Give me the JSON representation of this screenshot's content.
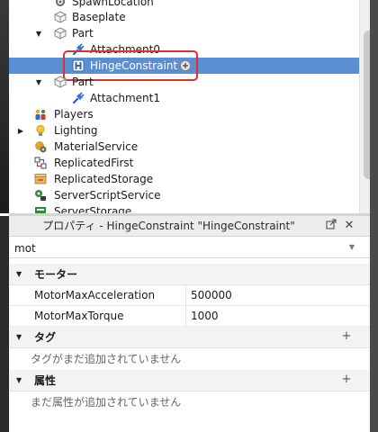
{
  "explorer": {
    "items": [
      {
        "label": "SpawnLocation",
        "icon": "spawn-icon"
      },
      {
        "label": "Baseplate",
        "icon": "part-icon"
      },
      {
        "label": "Part",
        "icon": "part-icon",
        "expanded": true
      },
      {
        "label": "Attachment0",
        "icon": "attachment-icon"
      },
      {
        "label": "HingeConstraint",
        "icon": "hinge-icon",
        "selected": true
      },
      {
        "label": "Part",
        "icon": "part-icon",
        "expanded": true
      },
      {
        "label": "Attachment1",
        "icon": "attachment-icon"
      },
      {
        "label": "Players",
        "icon": "players-icon"
      },
      {
        "label": "Lighting",
        "icon": "lighting-icon"
      },
      {
        "label": "MaterialService",
        "icon": "material-service-icon"
      },
      {
        "label": "ReplicatedFirst",
        "icon": "replicated-first-icon"
      },
      {
        "label": "ReplicatedStorage",
        "icon": "replicated-storage-icon"
      },
      {
        "label": "ServerScriptService",
        "icon": "server-script-service-icon"
      },
      {
        "label": "ServerStorage",
        "icon": "server-storage-icon"
      }
    ],
    "colors": {
      "selection": "#5a8fd4",
      "highlight": "#e0312b"
    }
  },
  "properties": {
    "title": "プロパティ - HingeConstraint \"HingeConstraint\"",
    "filter_value": "mot",
    "sections": [
      {
        "label": "モーター",
        "rows": [
          {
            "name": "MotorMaxAcceleration",
            "value": "500000"
          },
          {
            "name": "MotorMaxTorque",
            "value": "1000"
          }
        ]
      },
      {
        "label": "タグ",
        "empty_text": "タグがまだ追加されていません"
      },
      {
        "label": "属性",
        "empty_text": "まだ属性が追加されていません"
      }
    ]
  }
}
